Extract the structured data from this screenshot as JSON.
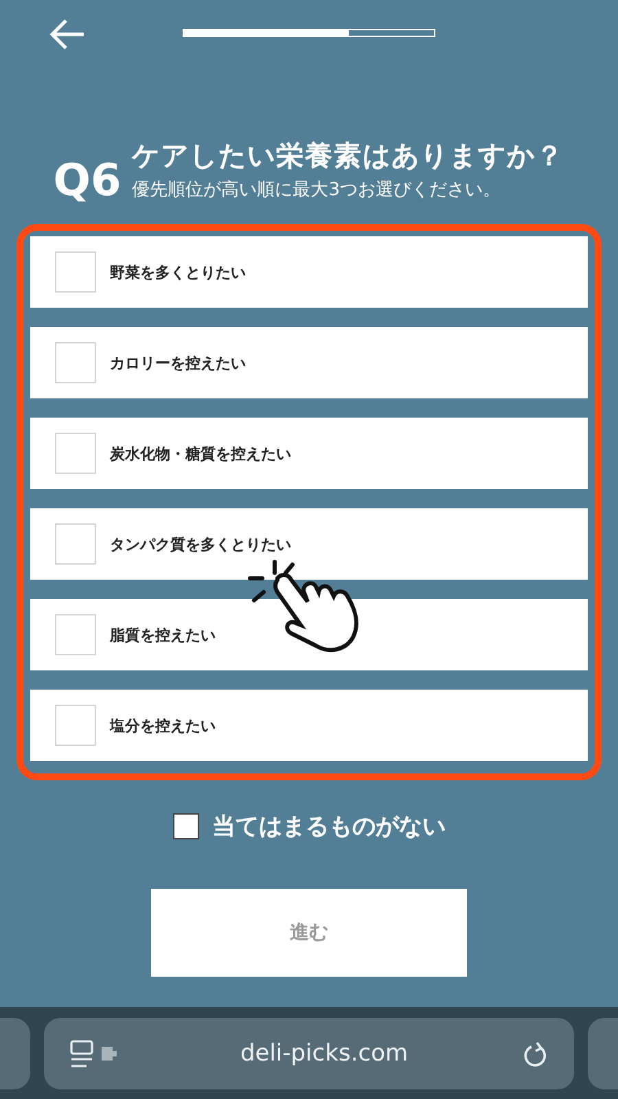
{
  "header": {
    "progress": {
      "level": 0.66
    }
  },
  "question": {
    "number": "Q6",
    "title": "ケアしたい栄養素はありますか？",
    "subtitle": "優先順位が高い順に最大3つお選びください。"
  },
  "options": [
    {
      "label": "野菜を多くとりたい",
      "checked": false
    },
    {
      "label": "カロリーを控えたい",
      "checked": false
    },
    {
      "label": "炭水化物・糖質を控えたい",
      "checked": false
    },
    {
      "label": "タンパク質を多くとりたい",
      "checked": false
    },
    {
      "label": "脂質を控えたい",
      "checked": false
    },
    {
      "label": "塩分を控えたい",
      "checked": false
    }
  ],
  "none_option": {
    "label": "当てはまるものがない",
    "checked": false
  },
  "next_button": {
    "label": "進む",
    "disabled": true
  },
  "browser_bar": {
    "url": "deli-picks.com"
  }
}
